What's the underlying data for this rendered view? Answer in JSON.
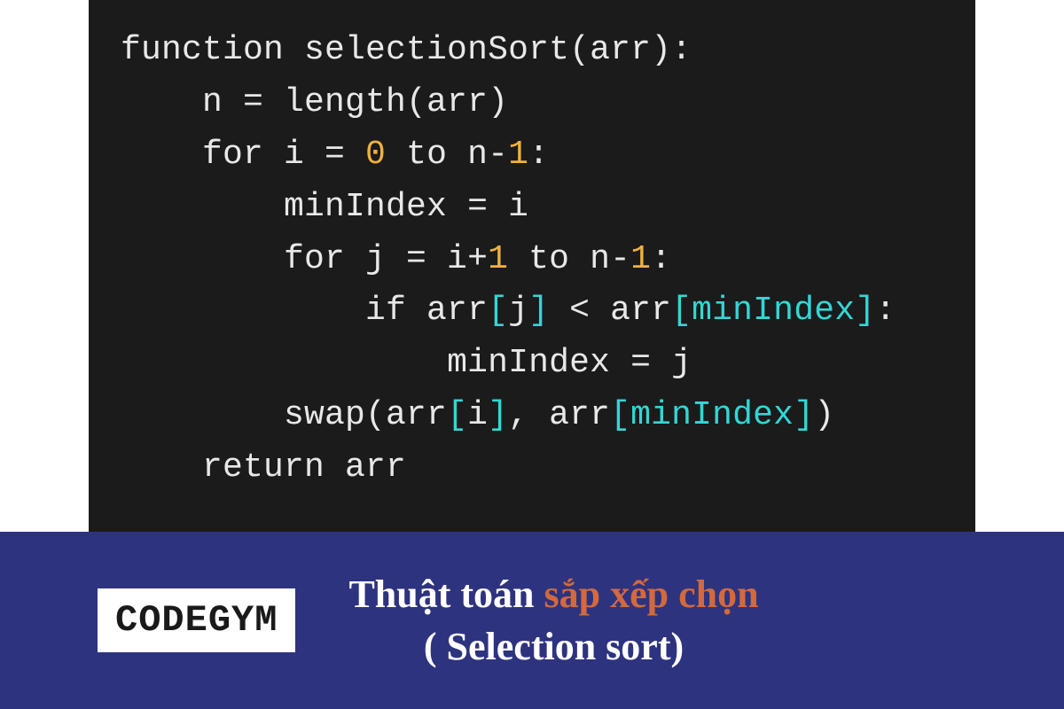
{
  "code": {
    "lines": [
      {
        "indent": 0,
        "tokens": [
          {
            "t": "function selectionSort(arr):",
            "c": "tok-white"
          }
        ]
      },
      {
        "indent": 1,
        "tokens": [
          {
            "t": "n = length(arr)",
            "c": "tok-white"
          }
        ]
      },
      {
        "indent": 1,
        "tokens": [
          {
            "t": "for i = ",
            "c": "tok-white"
          },
          {
            "t": "0",
            "c": "tok-num"
          },
          {
            "t": " to n-",
            "c": "tok-white"
          },
          {
            "t": "1",
            "c": "tok-num"
          },
          {
            "t": ":",
            "c": "tok-white"
          }
        ]
      },
      {
        "indent": 2,
        "tokens": [
          {
            "t": "minIndex = i",
            "c": "tok-white"
          }
        ]
      },
      {
        "indent": 2,
        "tokens": [
          {
            "t": "for j = i+",
            "c": "tok-white"
          },
          {
            "t": "1",
            "c": "tok-num"
          },
          {
            "t": " to n-",
            "c": "tok-white"
          },
          {
            "t": "1",
            "c": "tok-num"
          },
          {
            "t": ":",
            "c": "tok-white"
          }
        ]
      },
      {
        "indent": 3,
        "tokens": [
          {
            "t": "if arr",
            "c": "tok-white"
          },
          {
            "t": "[",
            "c": "tok-bracket"
          },
          {
            "t": "j",
            "c": "tok-white"
          },
          {
            "t": "]",
            "c": "tok-bracket"
          },
          {
            "t": " < arr",
            "c": "tok-white"
          },
          {
            "t": "[",
            "c": "tok-bracket"
          },
          {
            "t": "minIndex",
            "c": "tok-var"
          },
          {
            "t": "]",
            "c": "tok-bracket"
          },
          {
            "t": ":",
            "c": "tok-white"
          }
        ]
      },
      {
        "indent": 4,
        "tokens": [
          {
            "t": "minIndex = j",
            "c": "tok-white"
          }
        ]
      },
      {
        "indent": 2,
        "tokens": [
          {
            "t": "swap(arr",
            "c": "tok-white"
          },
          {
            "t": "[",
            "c": "tok-bracket"
          },
          {
            "t": "i",
            "c": "tok-white"
          },
          {
            "t": "]",
            "c": "tok-bracket"
          },
          {
            "t": ", arr",
            "c": "tok-white"
          },
          {
            "t": "[",
            "c": "tok-bracket"
          },
          {
            "t": "minIndex",
            "c": "tok-var"
          },
          {
            "t": "]",
            "c": "tok-bracket"
          },
          {
            "t": ")",
            "c": "tok-white"
          }
        ]
      },
      {
        "indent": 1,
        "tokens": [
          {
            "t": "return arr",
            "c": "tok-white"
          }
        ]
      }
    ]
  },
  "footer": {
    "logo": "CODEGYM",
    "title_part1": "Thuật toán ",
    "title_accent": "sắp xếp chọn",
    "title_part2": "( Selection sort)"
  }
}
